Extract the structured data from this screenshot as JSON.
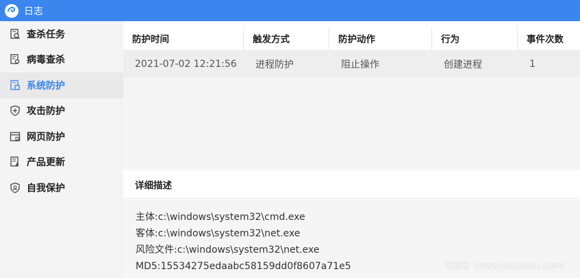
{
  "titlebar": {
    "title": "日志",
    "logo_icon": "app-logo-icon"
  },
  "colors": {
    "accent": "#3a86ee",
    "sidebar_bg": "#f4f4f4",
    "active_bg": "#e9e9e9",
    "panel_bg": "#f5f5f5"
  },
  "sidebar": {
    "items": [
      {
        "label": "查杀任务",
        "icon": "scan-task-icon",
        "active": false
      },
      {
        "label": "病毒查杀",
        "icon": "virus-scan-icon",
        "active": false
      },
      {
        "label": "系统防护",
        "icon": "system-protect-icon",
        "active": true
      },
      {
        "label": "攻击防护",
        "icon": "attack-shield-icon",
        "active": false
      },
      {
        "label": "网页防护",
        "icon": "web-protect-icon",
        "active": false
      },
      {
        "label": "产品更新",
        "icon": "update-icon",
        "active": false
      },
      {
        "label": "自我保护",
        "icon": "self-protect-icon",
        "active": false
      }
    ]
  },
  "table": {
    "columns": [
      "防护时间",
      "触发方式",
      "防护动作",
      "行为",
      "事件次数"
    ],
    "rows": [
      [
        "2021-07-02 12:21:56",
        "进程防护",
        "阻止操作",
        "创建进程",
        "1"
      ]
    ]
  },
  "detail": {
    "title": "详细描述",
    "lines": [
      "主体:c:\\windows\\system32\\cmd.exe",
      "客体:c:\\windows\\system32\\net.exe",
      "风险文件:c:\\windows\\system32\\net.exe",
      "MD5:15534275edaabc58159dd0f8607a71e5"
    ]
  },
  "watermark": "安全客（www.anquanke.com）"
}
